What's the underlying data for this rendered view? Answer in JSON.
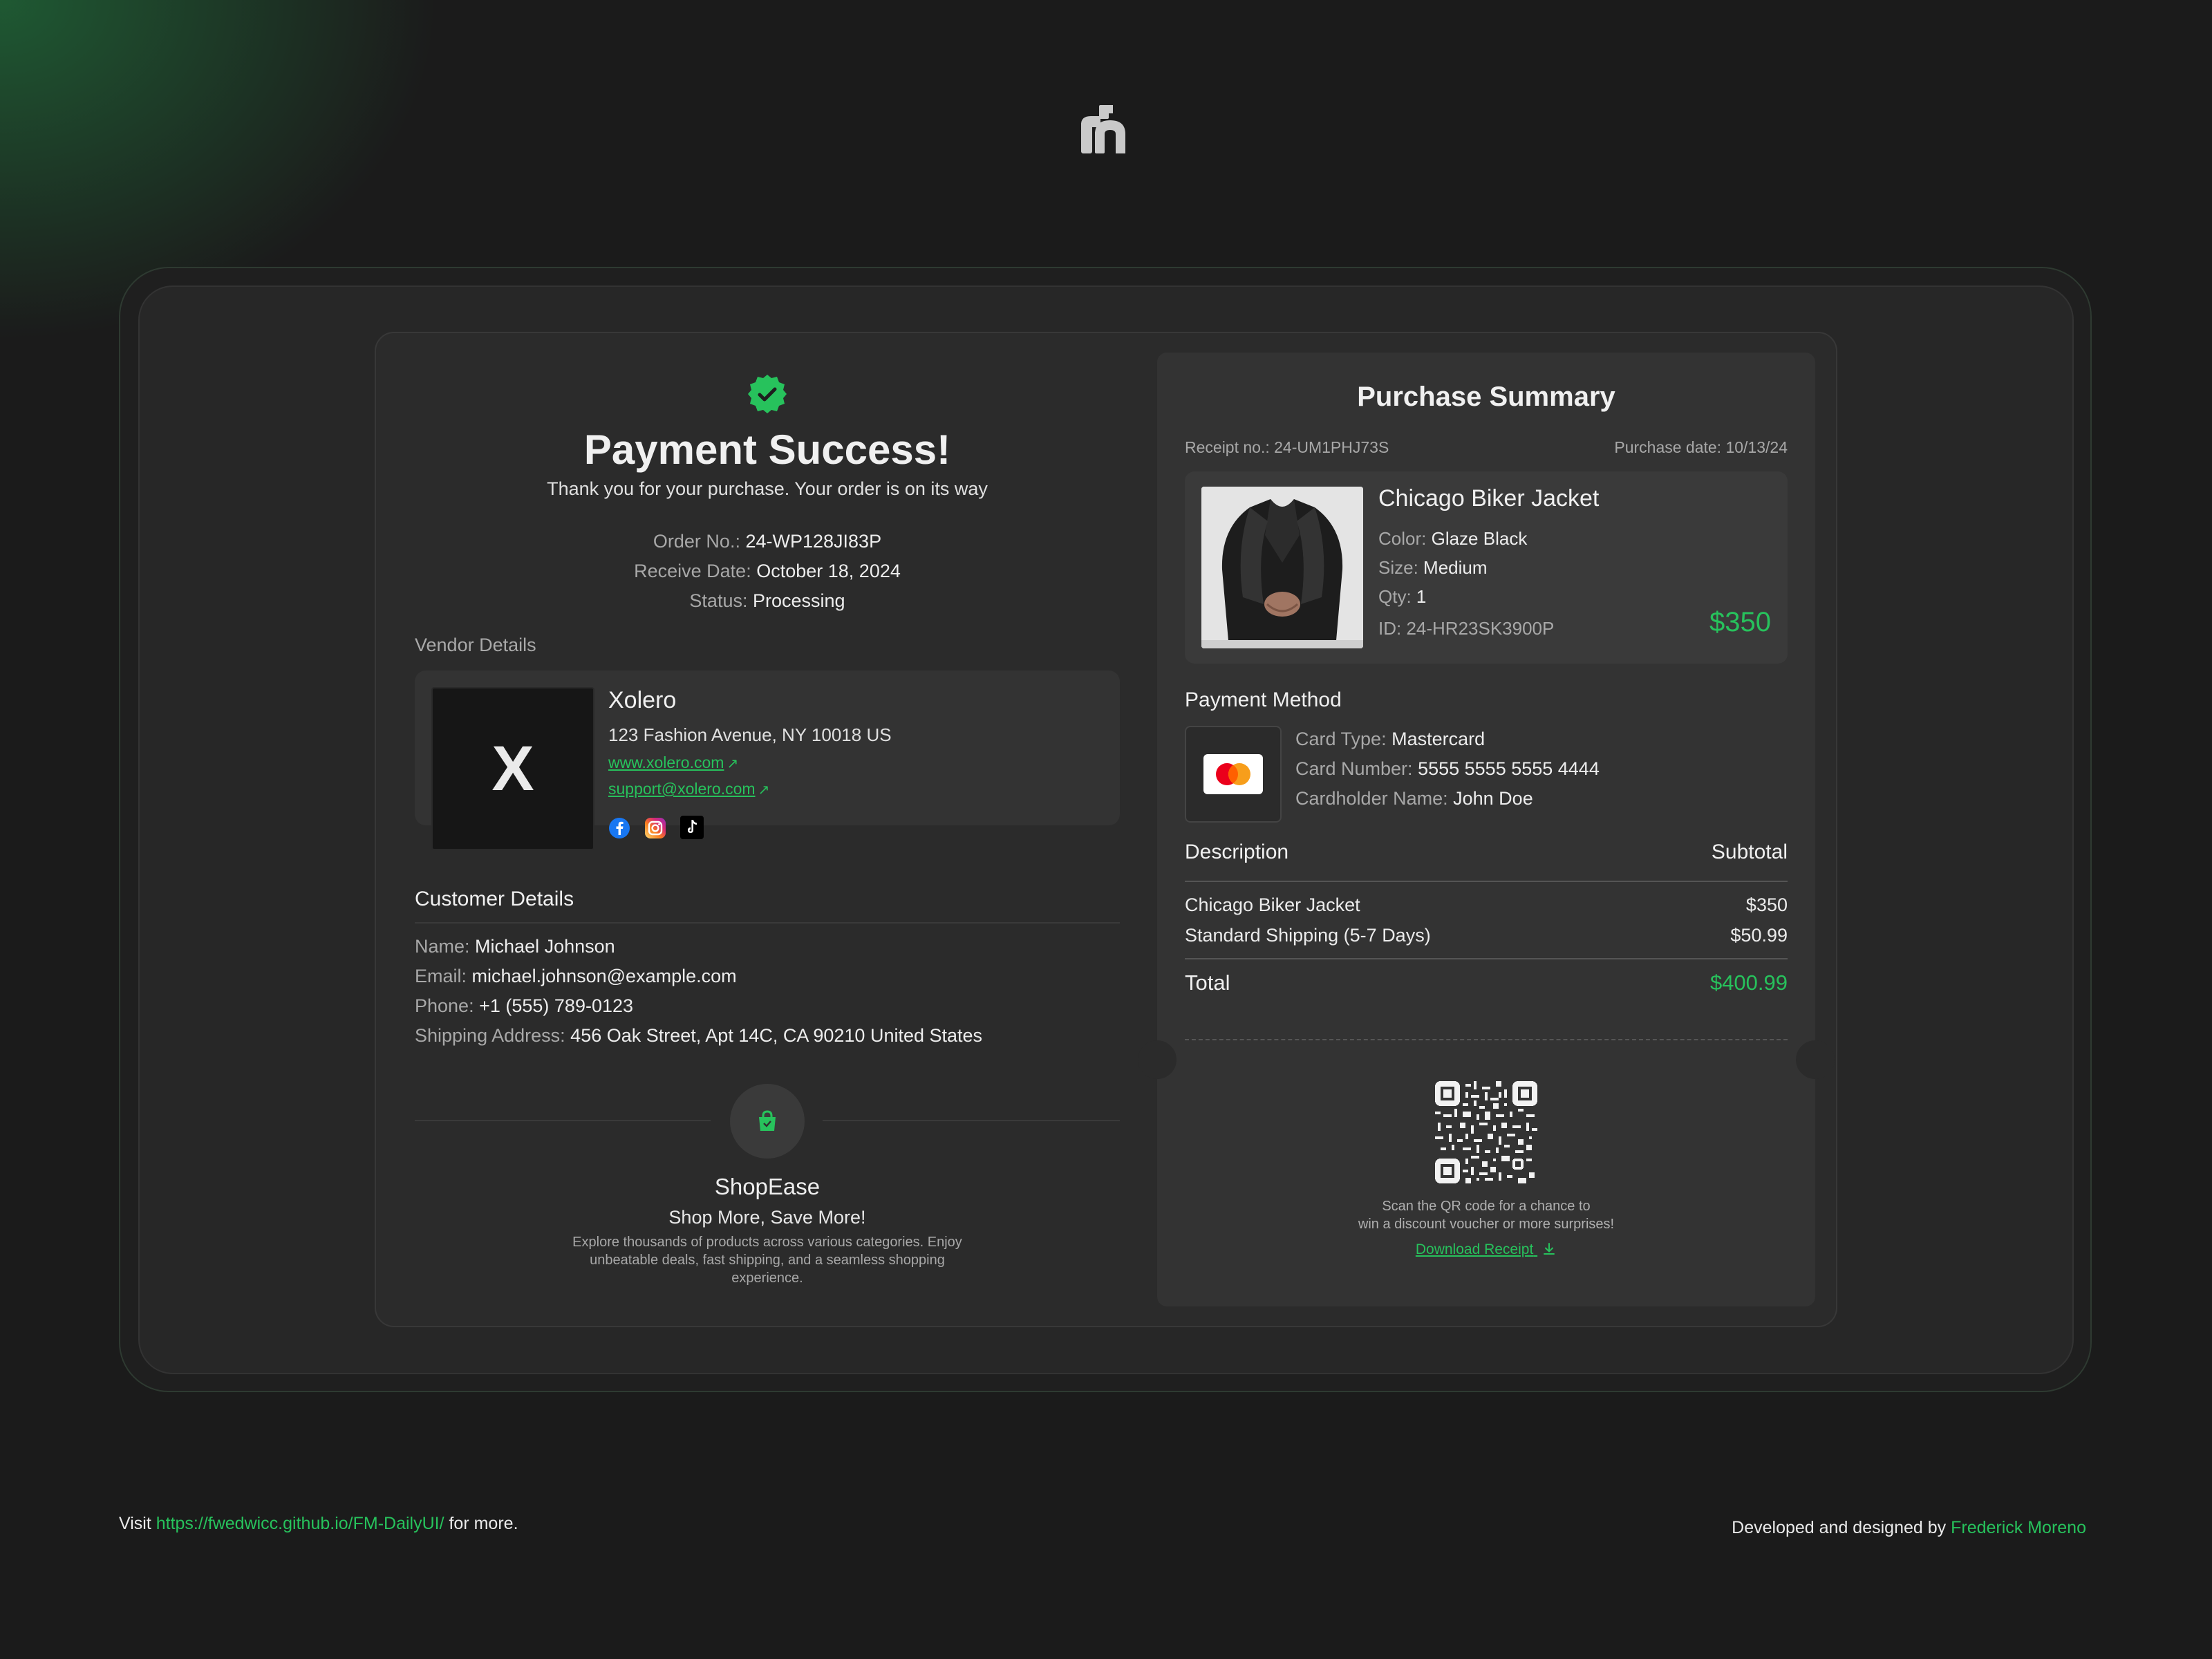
{
  "page": {
    "accent_color": "#27c25c",
    "background_color": "#1b1b1b"
  },
  "logo": {
    "icon": "fm-logo-icon"
  },
  "success": {
    "icon": "check-badge-icon",
    "title": "Payment Success!",
    "subtitle": "Thank you for your purchase. Your order is on its way",
    "order_no_label": "Order No.:",
    "order_no": "24-WP128JI83P",
    "receive_date_label": "Receive Date:",
    "receive_date": "October 18, 2024",
    "status_label": "Status:",
    "status": "Processing"
  },
  "vendor": {
    "section_label": "Vendor Details",
    "logo_letter": "X",
    "name": "Xolero",
    "address": "123 Fashion Avenue, NY 10018 US",
    "website": "www.xolero.com",
    "email": "support@xolero.com",
    "socials": [
      "facebook-icon",
      "instagram-icon",
      "tiktok-icon"
    ]
  },
  "customer": {
    "title": "Customer Details",
    "name_label": "Name:",
    "name": "Michael Johnson",
    "email_label": "Email:",
    "email": "michael.johnson@example.com",
    "phone_label": "Phone:",
    "phone": "+1 (555) 789-0123",
    "address_label": "Shipping Address:",
    "address": "456 Oak Street, Apt 14C, CA 90210 United States"
  },
  "shop": {
    "icon": "shopping-bag-icon",
    "name": "ShopEase",
    "tagline": "Shop More, Save More!",
    "description": "Explore thousands of products across various categories. Enjoy unbeatable deals, fast shipping, and a seamless shopping experience."
  },
  "summary": {
    "title": "Purchase Summary",
    "receipt_no": "Receipt no.: 24-UM1PHJ73S",
    "purchase_date": "Purchase date: 10/13/24",
    "item": {
      "image": "jacket-photo",
      "name": "Chicago Biker Jacket",
      "color_label": "Color:",
      "color": "Glaze Black",
      "size_label": "Size:",
      "size": "Medium",
      "qty_label": "Qty:",
      "qty": "1",
      "id": "ID: 24-HR23SK3900P",
      "price": "$350"
    },
    "payment": {
      "title": "Payment Method",
      "card_icon": "mastercard-icon",
      "card_type_label": "Card Type:",
      "card_type": "Mastercard",
      "card_number_label": "Card Number:",
      "card_number": "5555 5555 5555 4444",
      "holder_label": "Cardholder Name:",
      "holder": "John Doe"
    },
    "table": {
      "desc_header": "Description",
      "subtotal_header": "Subtotal",
      "rows": [
        {
          "desc": "Chicago Biker Jacket",
          "amount": "$350"
        },
        {
          "desc": "Standard Shipping (5-7 Days)",
          "amount": "$50.99"
        }
      ],
      "total_label": "Total",
      "total": "$400.99"
    },
    "qr_icon": "qr-code-icon",
    "qr_text_1": "Scan the QR code for a chance to",
    "qr_text_2": "win a discount voucher or more surprises!",
    "download_label": "Download Receipt"
  },
  "footer": {
    "visit_prefix": "Visit",
    "visit_link": "https://fwedwicc.github.io/FM-DailyUI/",
    "visit_suffix": "for more.",
    "credit_prefix": "Developed and designed by",
    "credit_name": "Frederick Moreno"
  }
}
